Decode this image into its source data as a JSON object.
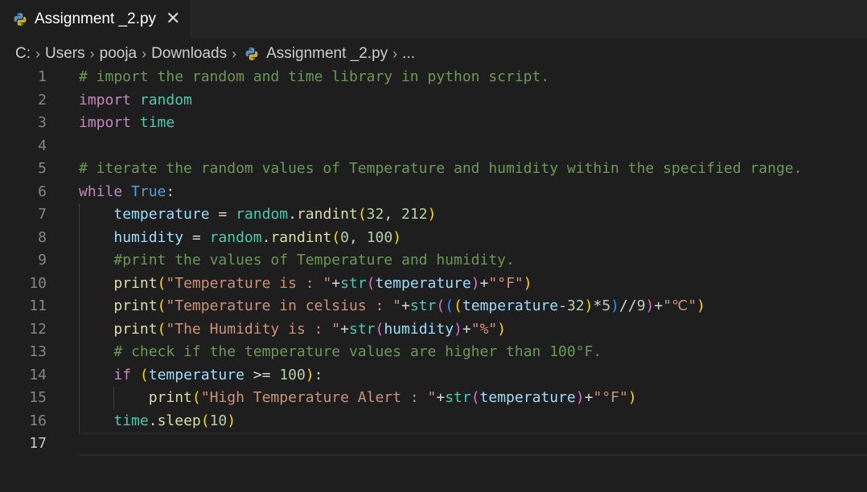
{
  "tab": {
    "label": "Assignment _2.py",
    "close": "✕"
  },
  "breadcrumb": {
    "items": [
      "C:",
      "Users",
      "pooja",
      "Downloads",
      "Assignment _2.py",
      "..."
    ],
    "separator": "›"
  },
  "editor": {
    "active_line": 17,
    "lines": [
      {
        "n": "1",
        "tokens": [
          {
            "t": "# import the random and time library in python script.",
            "c": "comment"
          }
        ]
      },
      {
        "n": "2",
        "tokens": [
          {
            "t": "import",
            "c": "kw"
          },
          {
            "t": " ",
            "c": "op"
          },
          {
            "t": "random",
            "c": "mod"
          }
        ]
      },
      {
        "n": "3",
        "tokens": [
          {
            "t": "import",
            "c": "kw"
          },
          {
            "t": " ",
            "c": "op"
          },
          {
            "t": "time",
            "c": "mod"
          }
        ]
      },
      {
        "n": "4",
        "tokens": []
      },
      {
        "n": "5",
        "tokens": [
          {
            "t": "# iterate the random values of Temperature and humidity within the specified range.",
            "c": "comment"
          }
        ]
      },
      {
        "n": "6",
        "tokens": [
          {
            "t": "while",
            "c": "ctrl"
          },
          {
            "t": " ",
            "c": "op"
          },
          {
            "t": "True",
            "c": "const"
          },
          {
            "t": ":",
            "c": "op"
          }
        ]
      },
      {
        "n": "7",
        "tokens": [
          {
            "t": "    ",
            "c": "op"
          },
          {
            "t": "temperature",
            "c": "var"
          },
          {
            "t": " = ",
            "c": "op"
          },
          {
            "t": "random",
            "c": "mod"
          },
          {
            "t": ".",
            "c": "op"
          },
          {
            "t": "randint",
            "c": "fn"
          },
          {
            "t": "(",
            "c": "b1"
          },
          {
            "t": "32",
            "c": "num"
          },
          {
            "t": ", ",
            "c": "op"
          },
          {
            "t": "212",
            "c": "num"
          },
          {
            "t": ")",
            "c": "b1"
          }
        ]
      },
      {
        "n": "8",
        "tokens": [
          {
            "t": "    ",
            "c": "op"
          },
          {
            "t": "humidity",
            "c": "var"
          },
          {
            "t": " = ",
            "c": "op"
          },
          {
            "t": "random",
            "c": "mod"
          },
          {
            "t": ".",
            "c": "op"
          },
          {
            "t": "randint",
            "c": "fn"
          },
          {
            "t": "(",
            "c": "b1"
          },
          {
            "t": "0",
            "c": "num"
          },
          {
            "t": ", ",
            "c": "op"
          },
          {
            "t": "100",
            "c": "num"
          },
          {
            "t": ")",
            "c": "b1"
          }
        ]
      },
      {
        "n": "9",
        "tokens": [
          {
            "t": "    ",
            "c": "op"
          },
          {
            "t": "#print the values of Temperature and humidity.",
            "c": "comment"
          }
        ]
      },
      {
        "n": "10",
        "tokens": [
          {
            "t": "    ",
            "c": "op"
          },
          {
            "t": "print",
            "c": "fn"
          },
          {
            "t": "(",
            "c": "b1"
          },
          {
            "t": "\"Temperature is : \"",
            "c": "str"
          },
          {
            "t": "+",
            "c": "op"
          },
          {
            "t": "str",
            "c": "mod"
          },
          {
            "t": "(",
            "c": "b2"
          },
          {
            "t": "temperature",
            "c": "var"
          },
          {
            "t": ")",
            "c": "b2"
          },
          {
            "t": "+",
            "c": "op"
          },
          {
            "t": "\"°F\"",
            "c": "str"
          },
          {
            "t": ")",
            "c": "b1"
          }
        ]
      },
      {
        "n": "11",
        "tokens": [
          {
            "t": "    ",
            "c": "op"
          },
          {
            "t": "print",
            "c": "fn"
          },
          {
            "t": "(",
            "c": "b1"
          },
          {
            "t": "\"Temperature in celsius : \"",
            "c": "str"
          },
          {
            "t": "+",
            "c": "op"
          },
          {
            "t": "str",
            "c": "mod"
          },
          {
            "t": "(",
            "c": "b2"
          },
          {
            "t": "(",
            "c": "b3"
          },
          {
            "t": "(",
            "c": "b1"
          },
          {
            "t": "temperature",
            "c": "var"
          },
          {
            "t": "-",
            "c": "op"
          },
          {
            "t": "32",
            "c": "num"
          },
          {
            "t": ")",
            "c": "b1"
          },
          {
            "t": "*",
            "c": "op"
          },
          {
            "t": "5",
            "c": "num"
          },
          {
            "t": ")",
            "c": "b3"
          },
          {
            "t": "//",
            "c": "op"
          },
          {
            "t": "9",
            "c": "num"
          },
          {
            "t": ")",
            "c": "b2"
          },
          {
            "t": "+",
            "c": "op"
          },
          {
            "t": "\"℃\"",
            "c": "str"
          },
          {
            "t": ")",
            "c": "b1"
          }
        ]
      },
      {
        "n": "12",
        "tokens": [
          {
            "t": "    ",
            "c": "op"
          },
          {
            "t": "print",
            "c": "fn"
          },
          {
            "t": "(",
            "c": "b1"
          },
          {
            "t": "\"The Humidity is : \"",
            "c": "str"
          },
          {
            "t": "+",
            "c": "op"
          },
          {
            "t": "str",
            "c": "mod"
          },
          {
            "t": "(",
            "c": "b2"
          },
          {
            "t": "humidity",
            "c": "var"
          },
          {
            "t": ")",
            "c": "b2"
          },
          {
            "t": "+",
            "c": "op"
          },
          {
            "t": "\"%\"",
            "c": "str"
          },
          {
            "t": ")",
            "c": "b1"
          }
        ]
      },
      {
        "n": "13",
        "tokens": [
          {
            "t": "    ",
            "c": "op"
          },
          {
            "t": "# check if the temperature values are higher than 100°F.",
            "c": "comment"
          }
        ]
      },
      {
        "n": "14",
        "tokens": [
          {
            "t": "    ",
            "c": "op"
          },
          {
            "t": "if",
            "c": "ctrl"
          },
          {
            "t": " ",
            "c": "op"
          },
          {
            "t": "(",
            "c": "b1"
          },
          {
            "t": "temperature",
            "c": "var"
          },
          {
            "t": " >= ",
            "c": "op"
          },
          {
            "t": "100",
            "c": "num"
          },
          {
            "t": ")",
            "c": "b1"
          },
          {
            "t": ":",
            "c": "op"
          }
        ]
      },
      {
        "n": "15",
        "tokens": [
          {
            "t": "        ",
            "c": "op"
          },
          {
            "t": "print",
            "c": "fn"
          },
          {
            "t": "(",
            "c": "b1"
          },
          {
            "t": "\"High Temperature Alert : \"",
            "c": "str"
          },
          {
            "t": "+",
            "c": "op"
          },
          {
            "t": "str",
            "c": "mod"
          },
          {
            "t": "(",
            "c": "b2"
          },
          {
            "t": "temperature",
            "c": "var"
          },
          {
            "t": ")",
            "c": "b2"
          },
          {
            "t": "+",
            "c": "op"
          },
          {
            "t": "\"°F\"",
            "c": "str"
          },
          {
            "t": ")",
            "c": "b1"
          }
        ]
      },
      {
        "n": "16",
        "tokens": [
          {
            "t": "    ",
            "c": "op"
          },
          {
            "t": "time",
            "c": "mod"
          },
          {
            "t": ".",
            "c": "op"
          },
          {
            "t": "sleep",
            "c": "fn"
          },
          {
            "t": "(",
            "c": "b1"
          },
          {
            "t": "10",
            "c": "num"
          },
          {
            "t": ")",
            "c": "b1"
          }
        ]
      },
      {
        "n": "17",
        "tokens": []
      }
    ]
  },
  "colors": {
    "background": "#1e1e1e",
    "comment": "#6a9955",
    "keyword": "#c586c0",
    "variable": "#9cdcfe",
    "module": "#4ec9b0",
    "function": "#dcdcaa",
    "string": "#ce9178",
    "number": "#b5cea8"
  },
  "icons": {
    "file": "python-icon",
    "close": "close-icon",
    "separator": "chevron-right-icon"
  }
}
